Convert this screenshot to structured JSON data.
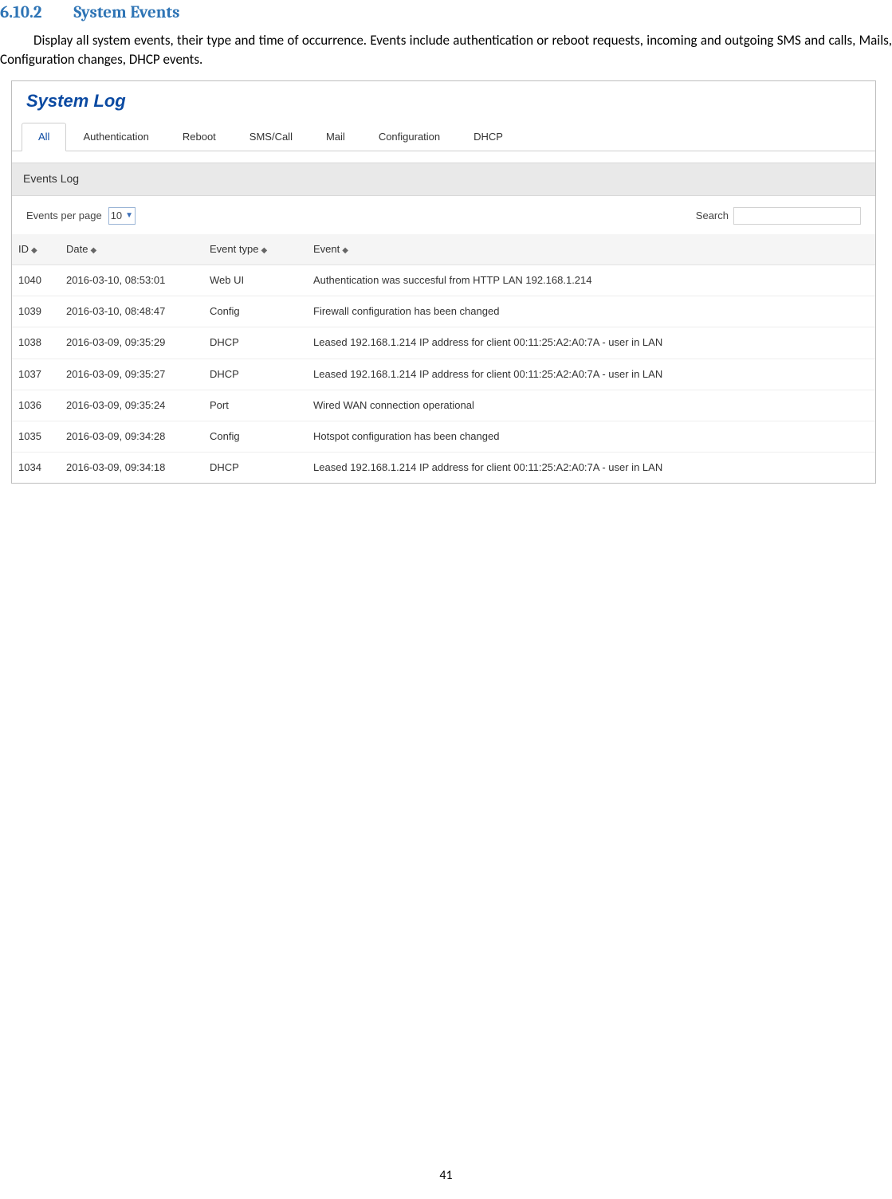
{
  "doc": {
    "section_number": "6.10.2",
    "section_title": "System Events",
    "body": "Display all system events, their type and time of occurrence. Events include authentication or reboot requests, incoming and outgoing SMS and calls, Mails, Configuration changes, DHCP events.",
    "page_number": "41"
  },
  "panel": {
    "title": "System Log",
    "section_bar": "Events Log",
    "tabs": [
      "All",
      "Authentication",
      "Reboot",
      "SMS/Call",
      "Mail",
      "Configuration",
      "DHCP"
    ],
    "active_tab_index": 0
  },
  "controls": {
    "epp_label": "Events per page",
    "epp_value": "10",
    "search_label": "Search",
    "search_value": ""
  },
  "table": {
    "headers": {
      "id": "ID",
      "date": "Date",
      "type": "Event type",
      "event": "Event"
    },
    "rows": [
      {
        "id": "1040",
        "date": "2016-03-10, 08:53:01",
        "type": "Web UI",
        "event": "Authentication was succesful from HTTP LAN 192.168.1.214"
      },
      {
        "id": "1039",
        "date": "2016-03-10, 08:48:47",
        "type": "Config",
        "event": "Firewall configuration has been changed"
      },
      {
        "id": "1038",
        "date": "2016-03-09, 09:35:29",
        "type": "DHCP",
        "event": "Leased 192.168.1.214 IP address for client 00:11:25:A2:A0:7A - user in LAN"
      },
      {
        "id": "1037",
        "date": "2016-03-09, 09:35:27",
        "type": "DHCP",
        "event": "Leased 192.168.1.214 IP address for client 00:11:25:A2:A0:7A - user in LAN"
      },
      {
        "id": "1036",
        "date": "2016-03-09, 09:35:24",
        "type": "Port",
        "event": "Wired WAN connection operational"
      },
      {
        "id": "1035",
        "date": "2016-03-09, 09:34:28",
        "type": "Config",
        "event": "Hotspot configuration has been changed"
      },
      {
        "id": "1034",
        "date": "2016-03-09, 09:34:18",
        "type": "DHCP",
        "event": "Leased 192.168.1.214 IP address for client 00:11:25:A2:A0:7A - user in LAN"
      }
    ]
  }
}
